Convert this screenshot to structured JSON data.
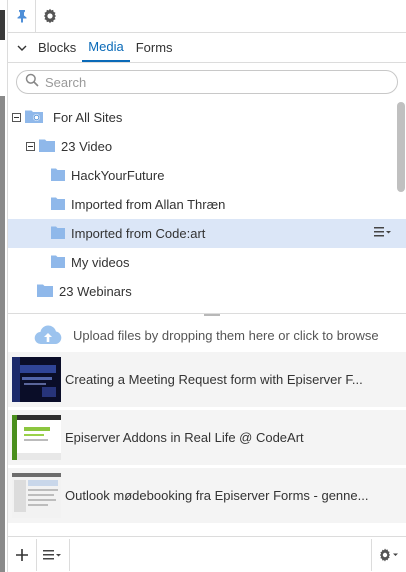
{
  "tabs": [
    {
      "label": "Blocks"
    },
    {
      "label": "Media"
    },
    {
      "label": "Forms"
    }
  ],
  "search": {
    "placeholder": "Search",
    "value": ""
  },
  "tree": {
    "root": "For All Sites",
    "folder_video": "23 Video",
    "children": [
      "HackYourFuture",
      "Imported from Allan Thræn",
      "Imported from Code:art",
      "My videos"
    ],
    "folder_webinars": "23 Webinars",
    "selected": "Imported from Code:art"
  },
  "upload": {
    "text": "Upload files by dropping them here or click to browse"
  },
  "media": [
    {
      "title": "Creating a Meeting Request form with Episerver F..."
    },
    {
      "title": "Episerver Addons in Real Life @ CodeArt"
    },
    {
      "title": "Outlook mødebooking fra Episerver Forms - genne..."
    }
  ],
  "colors": {
    "accent": "#0a6ab8",
    "folder": "#8fb8ea",
    "selected_row": "#dbe6f7"
  }
}
